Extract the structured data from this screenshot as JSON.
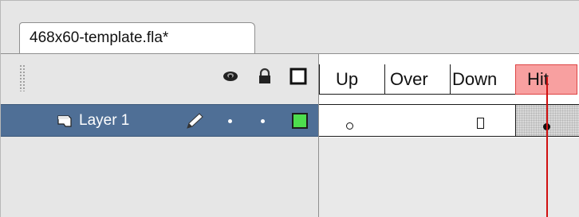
{
  "document_tab": {
    "title": "468x60-template.fla*"
  },
  "layer_header": {
    "icons": [
      "eye-icon",
      "lock-icon",
      "outline-icon"
    ]
  },
  "frames": {
    "labels": [
      "Up",
      "Over",
      "Down",
      "Hit"
    ],
    "current": "Hit",
    "hit_highlight_color": "#f8a0a0"
  },
  "layer": {
    "name": "Layer 1",
    "icon": "layer-page-icon",
    "edit_icon": "pencil-icon",
    "visibility_marker": "•",
    "lock_marker": "•",
    "outline_color": "#4ddd4d"
  },
  "keyframes": [
    {
      "frame": "Up",
      "type": "empty-keyframe"
    },
    {
      "frame": "Down",
      "type": "end-of-span"
    },
    {
      "frame": "Hit",
      "type": "filled-keyframe"
    }
  ],
  "colors": {
    "selected_layer_bg": "#4f6f96",
    "playhead": "#d01010"
  }
}
